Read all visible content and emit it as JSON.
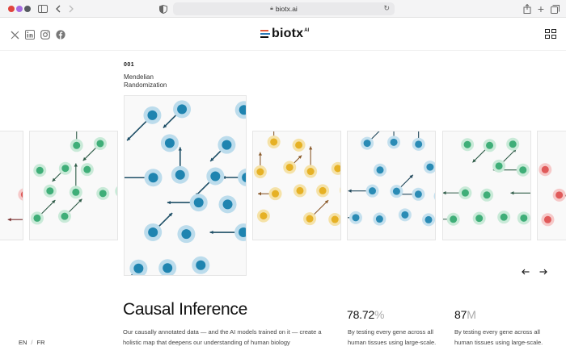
{
  "browser": {
    "url": "biotx.ai"
  },
  "header": {
    "logo_text": "biotx",
    "logo_sup": "AI",
    "social_icons": [
      "x-icon",
      "linkedin-icon",
      "instagram-icon",
      "facebook-icon"
    ]
  },
  "feature": {
    "number": "001",
    "title": "Mendelian Randomization"
  },
  "cards": [
    {
      "name": "card-red-partial-left",
      "color": "#e05a5a",
      "ring": "#f6c9c9"
    },
    {
      "name": "card-green-left",
      "color": "#3fae78",
      "ring": "#c9ead8"
    },
    {
      "name": "card-blue-featured",
      "color": "#1f84b0",
      "ring": "#bcdcec"
    },
    {
      "name": "card-orange",
      "color": "#e6b125",
      "ring": "#f5e2a8"
    },
    {
      "name": "card-blue",
      "color": "#2a8bb5",
      "ring": "#c4e0ee"
    },
    {
      "name": "card-green-right",
      "color": "#3fae78",
      "ring": "#c9ead8"
    },
    {
      "name": "card-red-partial-right",
      "color": "#e05a5a",
      "ring": "#f6c9c9"
    }
  ],
  "main": {
    "headline": "Causal Inference",
    "description": "Our causally annotated data — and the AI models trained on it — create a holistic map that deepens our understanding of human biology"
  },
  "stats": [
    {
      "value": "78.72",
      "unit": "%",
      "description": "By testing every gene across all human tissues using large-scale."
    },
    {
      "value": "87",
      "unit": "M",
      "description": "By testing every gene across all human tissues using large-scale."
    }
  ],
  "language": {
    "options": [
      "EN",
      "FR"
    ],
    "separator": "/"
  },
  "colors": {
    "logo_bars": [
      "#e55a3c",
      "#2a7ab8",
      "#111111"
    ]
  }
}
